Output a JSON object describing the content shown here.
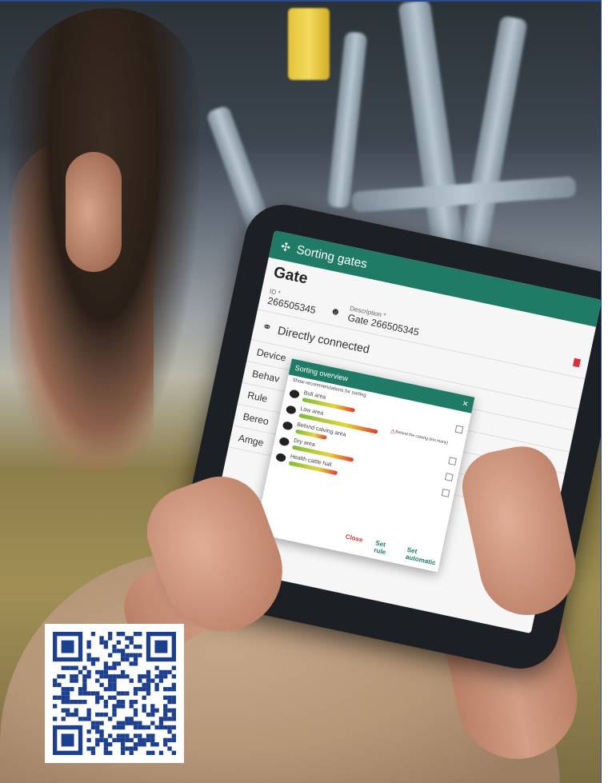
{
  "photo": {
    "app": {
      "header_title": "Sorting gates",
      "page_title": "Gate",
      "id_label": "ID *",
      "id_value": "266505345",
      "description_label": "Description *",
      "description_value": "Gate 266505345",
      "connection_label": "Directly connected",
      "side_labels": [
        "Device",
        "Behav",
        "Rule",
        "Bereo",
        "Amge"
      ]
    },
    "dialog": {
      "title": "Sorting overview",
      "subtitle": "Show recommendations for sorting",
      "entries": [
        {
          "label": "Bull area"
        },
        {
          "label": "Low area"
        },
        {
          "label": "Behind calving area"
        },
        {
          "label": "Dry area"
        },
        {
          "label": "Health cattle hall"
        }
      ],
      "warning": "Behind the calving (too many)",
      "actions": [
        "Close",
        "Set rule",
        "Set automatic"
      ]
    }
  },
  "colors": {
    "app_green": "#1f7a66",
    "alert_red": "#d8303c"
  },
  "qr_code": {
    "icon": "qr-code-icon"
  }
}
